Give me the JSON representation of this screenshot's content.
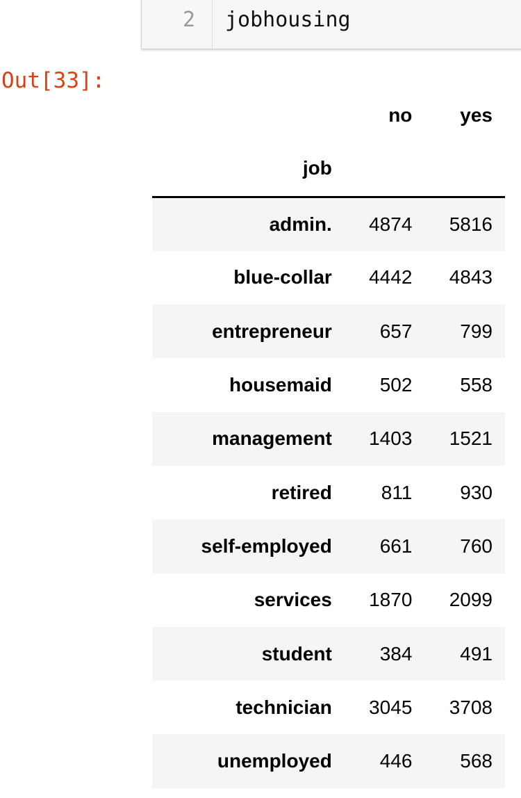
{
  "cell": {
    "line_number": "2",
    "code": "jobhousing",
    "prompt": "Out[33]:"
  },
  "table": {
    "columns": [
      "no",
      "yes"
    ],
    "index_name": "job",
    "rows": [
      {
        "job": "admin.",
        "no": "4874",
        "yes": "5816"
      },
      {
        "job": "blue-collar",
        "no": "4442",
        "yes": "4843"
      },
      {
        "job": "entrepreneur",
        "no": "657",
        "yes": "799"
      },
      {
        "job": "housemaid",
        "no": "502",
        "yes": "558"
      },
      {
        "job": "management",
        "no": "1403",
        "yes": "1521"
      },
      {
        "job": "retired",
        "no": "811",
        "yes": "930"
      },
      {
        "job": "self-employed",
        "no": "661",
        "yes": "760"
      },
      {
        "job": "services",
        "no": "1870",
        "yes": "2099"
      },
      {
        "job": "student",
        "no": "384",
        "yes": "491"
      },
      {
        "job": "technician",
        "no": "3045",
        "yes": "3708"
      },
      {
        "job": "unemployed",
        "no": "446",
        "yes": "568"
      }
    ]
  }
}
